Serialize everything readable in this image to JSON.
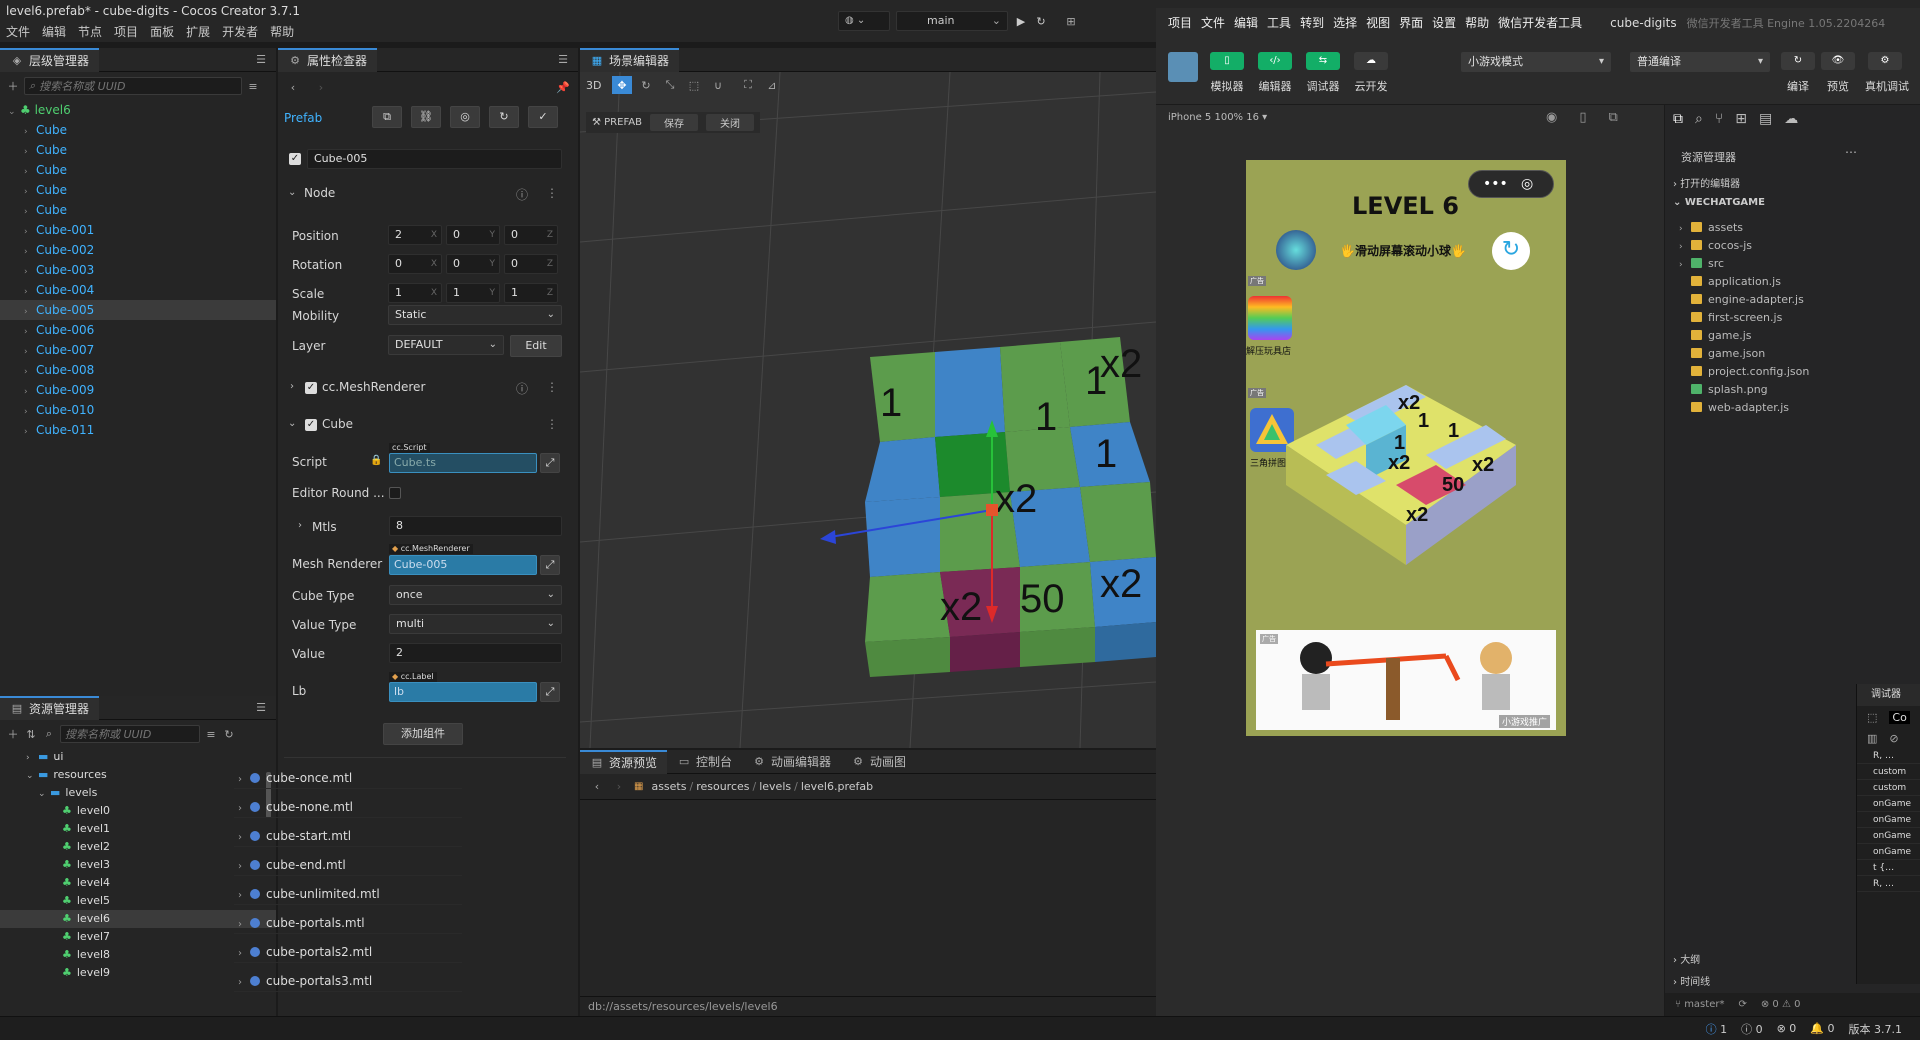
{
  "window": {
    "title": "level6.prefab* - cube-digits - Cocos Creator 3.7.1"
  },
  "menu": [
    "文件",
    "编辑",
    "节点",
    "项目",
    "面板",
    "扩展",
    "开发者",
    "帮助"
  ],
  "toolbar": {
    "scene_select": "main"
  },
  "hierarchy": {
    "tab": "层级管理器",
    "search_placeholder": "搜索名称或 UUID",
    "root": "level6",
    "items": [
      "Cube",
      "Cube",
      "Cube",
      "Cube",
      "Cube",
      "Cube-001",
      "Cube-002",
      "Cube-003",
      "Cube-004",
      "Cube-005",
      "Cube-006",
      "Cube-007",
      "Cube-008",
      "Cube-009",
      "Cube-010",
      "Cube-011"
    ],
    "selected_index": 9
  },
  "assets": {
    "tab": "资源管理器",
    "search_placeholder": "搜索名称或 UUID",
    "tree": [
      {
        "label": "ui",
        "depth": 1,
        "type": "folder",
        "arrow": "›"
      },
      {
        "label": "resources",
        "depth": 1,
        "type": "folder",
        "arrow": "⌄"
      },
      {
        "label": "levels",
        "depth": 2,
        "type": "folder",
        "arrow": "⌄"
      },
      {
        "label": "level0",
        "depth": 3,
        "type": "prefab"
      },
      {
        "label": "level1",
        "depth": 3,
        "type": "prefab"
      },
      {
        "label": "level2",
        "depth": 3,
        "type": "prefab"
      },
      {
        "label": "level3",
        "depth": 3,
        "type": "prefab"
      },
      {
        "label": "level4",
        "depth": 3,
        "type": "prefab"
      },
      {
        "label": "level5",
        "depth": 3,
        "type": "prefab"
      },
      {
        "label": "level6",
        "depth": 3,
        "type": "prefab",
        "selected": true
      },
      {
        "label": "level7",
        "depth": 3,
        "type": "prefab"
      },
      {
        "label": "level8",
        "depth": 3,
        "type": "prefab"
      },
      {
        "label": "level9",
        "depth": 3,
        "type": "prefab"
      }
    ]
  },
  "inspector": {
    "tab": "属性检查器",
    "prefab_label": "Prefab",
    "node_name": "Cube-005",
    "node_section": "Node",
    "position": {
      "label": "Position",
      "x": "2",
      "y": "0",
      "z": "0"
    },
    "rotation": {
      "label": "Rotation",
      "x": "0",
      "y": "0",
      "z": "0"
    },
    "scale": {
      "label": "Scale",
      "x": "1",
      "y": "1",
      "z": "1"
    },
    "axis": {
      "x": "X",
      "y": "Y",
      "z": "Z"
    },
    "mobility": {
      "label": "Mobility",
      "value": "Static"
    },
    "layer": {
      "label": "Layer",
      "value": "DEFAULT",
      "edit": "Edit"
    },
    "mesh_renderer_section": "cc.MeshRenderer",
    "cube_section": "Cube",
    "script": {
      "label": "Script",
      "tag": "cc.Script",
      "value": "Cube.ts"
    },
    "editor_round": {
      "label": "Editor Round ..."
    },
    "mtls": {
      "label": "Mtls",
      "value": "8"
    },
    "mesh_renderer": {
      "label": "Mesh Renderer",
      "tag": "cc.MeshRenderer",
      "value": "Cube-005"
    },
    "cube_type": {
      "label": "Cube Type",
      "value": "once"
    },
    "value_type": {
      "label": "Value Type",
      "value": "multi"
    },
    "value": {
      "label": "Value",
      "value": "2"
    },
    "lb": {
      "label": "Lb",
      "tag": "cc.Label",
      "value": "lb"
    },
    "add_component": "添加组件",
    "materials": [
      "cube-once.mtl",
      "cube-none.mtl",
      "cube-start.mtl",
      "cube-end.mtl",
      "cube-unlimited.mtl",
      "cube-portals.mtl",
      "cube-portals2.mtl",
      "cube-portals3.mtl"
    ]
  },
  "scene": {
    "tab": "场景编辑器",
    "mode_3d": "3D",
    "prefab_label": "PREFAB",
    "save": "保存",
    "close": "关闭",
    "grid_labels": [
      "1",
      "1",
      "x2",
      "1",
      "1",
      "x2",
      "x2",
      "50",
      "x2"
    ]
  },
  "bottom_panel": {
    "tabs": [
      "资源预览",
      "控制台",
      "动画编辑器",
      "动画图"
    ],
    "breadcrumb": [
      "assets",
      "resources",
      "levels",
      "level6.prefab"
    ],
    "status_path": "db://assets/resources/levels/level6"
  },
  "wechat": {
    "menu": [
      "项目",
      "文件",
      "编辑",
      "工具",
      "转到",
      "选择",
      "视图",
      "界面",
      "设置",
      "帮助",
      "微信开发者工具"
    ],
    "project": "cube-digits",
    "subtitle": "微信开发者工具 Engine 1.05.2204264",
    "tool_labels": [
      "模拟器",
      "编辑器",
      "调试器",
      "云开发"
    ],
    "mode_select": "小游戏模式",
    "compile_select": "普通编译",
    "right_labels": [
      "编译",
      "预览",
      "真机调试"
    ],
    "device": "iPhone 5 100% 16 ▾",
    "game": {
      "level_title": "LEVEL 6",
      "hint": "🖐滑动屏幕滚动小球🖐",
      "ad_tag": "广告",
      "ad1": "解压玩具店",
      "ad2": "三角拼图",
      "banner_label": "小游戏推广",
      "cube_labels": [
        "x2",
        "1",
        "1",
        "1",
        "x2",
        "x2",
        "50",
        "x2"
      ]
    },
    "explorer": {
      "title": "资源管理器",
      "open_editors": "打开的编辑器",
      "project_root": "WECHATGAME",
      "files": [
        {
          "name": "assets",
          "kind": "folder"
        },
        {
          "name": "cocos-js",
          "kind": "folder"
        },
        {
          "name": "src",
          "kind": "folder-green"
        },
        {
          "name": "application.js",
          "kind": "js"
        },
        {
          "name": "engine-adapter.js",
          "kind": "js"
        },
        {
          "name": "first-screen.js",
          "kind": "js"
        },
        {
          "name": "game.js",
          "kind": "js"
        },
        {
          "name": "game.json",
          "kind": "json"
        },
        {
          "name": "project.config.json",
          "kind": "json"
        },
        {
          "name": "splash.png",
          "kind": "png"
        },
        {
          "name": "web-adapter.js",
          "kind": "js"
        }
      ],
      "outline": "大纲",
      "timeline": "时间线"
    },
    "debugger": {
      "title": "调试器",
      "rows": [
        "R, …",
        "custom",
        "custom",
        "onGame",
        "onGame",
        "onGame",
        "onGame",
        "t {…",
        "R, …"
      ]
    },
    "statusbar": {
      "branch": "master*",
      "problems": "⊗ 0 ⚠ 0"
    }
  },
  "statusbar": {
    "info": "1",
    "warn": "0",
    "error": "0",
    "bell": "0",
    "version": "版本 3.7.1"
  },
  "colors": {
    "accent": "#3a8ad6",
    "tree_link": "#40b3ff",
    "wechat_green": "#13ae67"
  }
}
